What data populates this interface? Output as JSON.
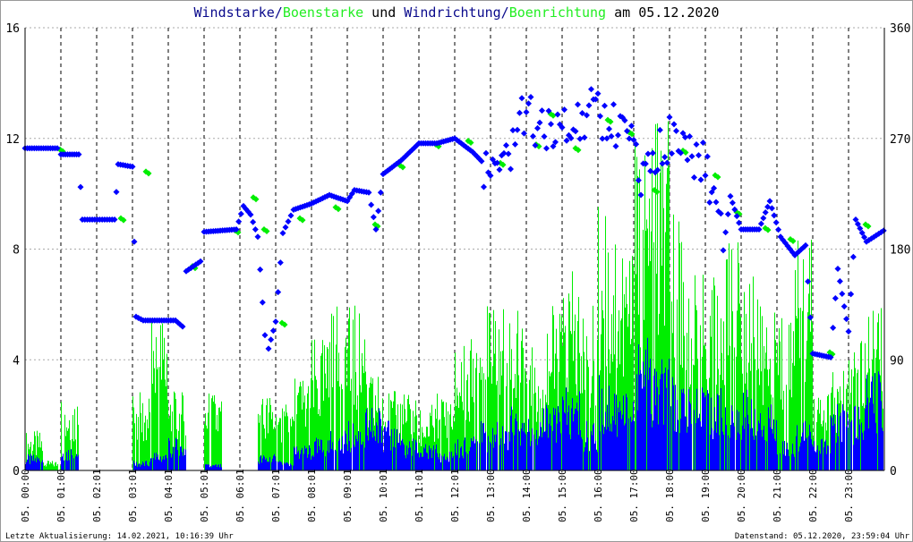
{
  "chart_data": {
    "type": "bar+scatter",
    "title_parts": [
      {
        "text": "Windstarke",
        "color": "#0a0a8c"
      },
      {
        "text": "/",
        "color": "#0a0a8c"
      },
      {
        "text": "Boenstarke",
        "color": "#22ee22"
      },
      {
        "text": " und ",
        "color": "#000000"
      },
      {
        "text": "Windrichtung",
        "color": "#0a0a8c"
      },
      {
        "text": "/",
        "color": "#0a0a8c"
      },
      {
        "text": "Boenrichtung",
        "color": "#22ee22"
      },
      {
        "text": " am 05.12.2020",
        "color": "#000000"
      }
    ],
    "left_axis": {
      "ylim": [
        0,
        16
      ],
      "ticks": [
        "0",
        "4",
        "8",
        "12",
        "16"
      ]
    },
    "right_axis": {
      "ylim": [
        0,
        360
      ],
      "ticks": [
        "0",
        "90",
        "180",
        "270",
        "360"
      ]
    },
    "x_range_hours": [
      0,
      24
    ],
    "x_ticks": [
      "05. 00:00",
      "05. 01:00",
      "05. 02:01",
      "05. 03:01",
      "05. 04:01",
      "05. 05:01",
      "05. 06:01",
      "05. 07:01",
      "05. 08:01",
      "05. 09:01",
      "05. 10:01",
      "05. 11:01",
      "05. 12:01",
      "05. 13:00",
      "05. 14:00",
      "05. 15:00",
      "05. 16:00",
      "05. 17:00",
      "05. 18:00",
      "05. 19:00",
      "05. 20:00",
      "05. 21:00",
      "05. 22:00",
      "05. 23:00"
    ],
    "series": [
      {
        "name": "Windstarke",
        "kind": "bar",
        "color": "#0000ff",
        "values_half_hourly": [
          0.5,
          0,
          0.8,
          0,
          0,
          0,
          0.3,
          0.6,
          1,
          0,
          0.2,
          0,
          0,
          0.5,
          0.3,
          0.8,
          1,
          1.2,
          1.5,
          2,
          1.5,
          1,
          0.8,
          0.6,
          1,
          1.5,
          1.5,
          2,
          2,
          2,
          2.5,
          1.5,
          3,
          2.5,
          4,
          3.5,
          3,
          2.5,
          2.5,
          2,
          2.5,
          2,
          1,
          1.5,
          1,
          2,
          2,
          3
        ]
      },
      {
        "name": "Boenstarke",
        "kind": "bar",
        "color": "#00ee00",
        "values_half_hourly": [
          1.2,
          0.3,
          2.4,
          0,
          0,
          0,
          2.4,
          5,
          2.4,
          0,
          2.4,
          0,
          0,
          2.4,
          2,
          3,
          4,
          5,
          5,
          3,
          2.4,
          2.4,
          2,
          2.4,
          4,
          5,
          5,
          5,
          4,
          5,
          6,
          5,
          8,
          7,
          10,
          11,
          8,
          6,
          6,
          7,
          6,
          5,
          5,
          7,
          2.4,
          3,
          4,
          5
        ]
      },
      {
        "name": "Windrichtung",
        "kind": "scatter",
        "color": "#0000ff",
        "points_hour_deg": [
          [
            0,
            262
          ],
          [
            0.9,
            262
          ],
          [
            1.0,
            257
          ],
          [
            1.5,
            257
          ],
          [
            1.6,
            204
          ],
          [
            2.5,
            204
          ],
          [
            2.6,
            249
          ],
          [
            3,
            247
          ],
          [
            3.1,
            125
          ],
          [
            3.3,
            122
          ],
          [
            4.2,
            122
          ],
          [
            4.4,
            117
          ],
          [
            4.5,
            162
          ],
          [
            4.9,
            170
          ],
          [
            5,
            194
          ],
          [
            5.9,
            196
          ],
          [
            6.1,
            215
          ],
          [
            6.3,
            208
          ],
          [
            6.5,
            190
          ],
          [
            6.7,
            110
          ],
          [
            6.8,
            99
          ],
          [
            7.0,
            121
          ],
          [
            7.2,
            193
          ],
          [
            7.5,
            212
          ],
          [
            8,
            217
          ],
          [
            8.5,
            224
          ],
          [
            9,
            219
          ],
          [
            9.2,
            228
          ],
          [
            9.6,
            226
          ],
          [
            9.8,
            196
          ],
          [
            10,
            241
          ],
          [
            10.5,
            252
          ],
          [
            11,
            266
          ],
          [
            11.5,
            266
          ],
          [
            12,
            270
          ],
          [
            12.5,
            259
          ],
          [
            13,
            244
          ],
          [
            13.5,
            259
          ],
          [
            14,
            295
          ],
          [
            14.5,
            273
          ],
          [
            15,
            281
          ],
          [
            15.5,
            288
          ],
          [
            16,
            292
          ],
          [
            16.5,
            281
          ],
          [
            17,
            259
          ],
          [
            17.2,
            226
          ],
          [
            17.6,
            255
          ],
          [
            18,
            273
          ],
          [
            18.5,
            262
          ],
          [
            19,
            252
          ],
          [
            19.3,
            215
          ],
          [
            19.5,
            179
          ],
          [
            19.7,
            223
          ],
          [
            20,
            196
          ],
          [
            20.5,
            196
          ],
          [
            20.8,
            219
          ],
          [
            21.1,
            190
          ],
          [
            21.5,
            175
          ],
          [
            21.8,
            183
          ],
          [
            22,
            95
          ],
          [
            22.5,
            92
          ],
          [
            22.7,
            164
          ],
          [
            23,
            113
          ],
          [
            23.2,
            204
          ],
          [
            23.5,
            186
          ],
          [
            23.98,
            195
          ]
        ]
      },
      {
        "name": "Boenrichtung",
        "kind": "scatter",
        "color": "#00ee00",
        "points_hour_deg": [
          [
            0.9,
            261
          ],
          [
            2.6,
            205
          ],
          [
            3.3,
            243
          ],
          [
            4.6,
            166
          ],
          [
            5.8,
            195
          ],
          [
            6.3,
            222
          ],
          [
            6.6,
            196
          ],
          [
            7.1,
            120
          ],
          [
            7.6,
            205
          ],
          [
            8.6,
            214
          ],
          [
            9.7,
            200
          ],
          [
            10.4,
            248
          ],
          [
            11.4,
            265
          ],
          [
            12.3,
            268
          ],
          [
            13.2,
            250
          ],
          [
            14.2,
            265
          ],
          [
            14.6,
            290
          ],
          [
            15.3,
            262
          ],
          [
            16.2,
            285
          ],
          [
            16.8,
            275
          ],
          [
            17.5,
            228
          ],
          [
            18.3,
            260
          ],
          [
            19.2,
            240
          ],
          [
            19.8,
            210
          ],
          [
            20.6,
            197
          ],
          [
            21.3,
            188
          ],
          [
            22.4,
            96
          ],
          [
            23.4,
            200
          ]
        ]
      }
    ]
  },
  "footer": {
    "left": "Letzte Aktualisierung: 14.02.2021, 10:16:39 Uhr",
    "right": "Datenstand: 05.12.2020, 23:59:04 Uhr"
  }
}
